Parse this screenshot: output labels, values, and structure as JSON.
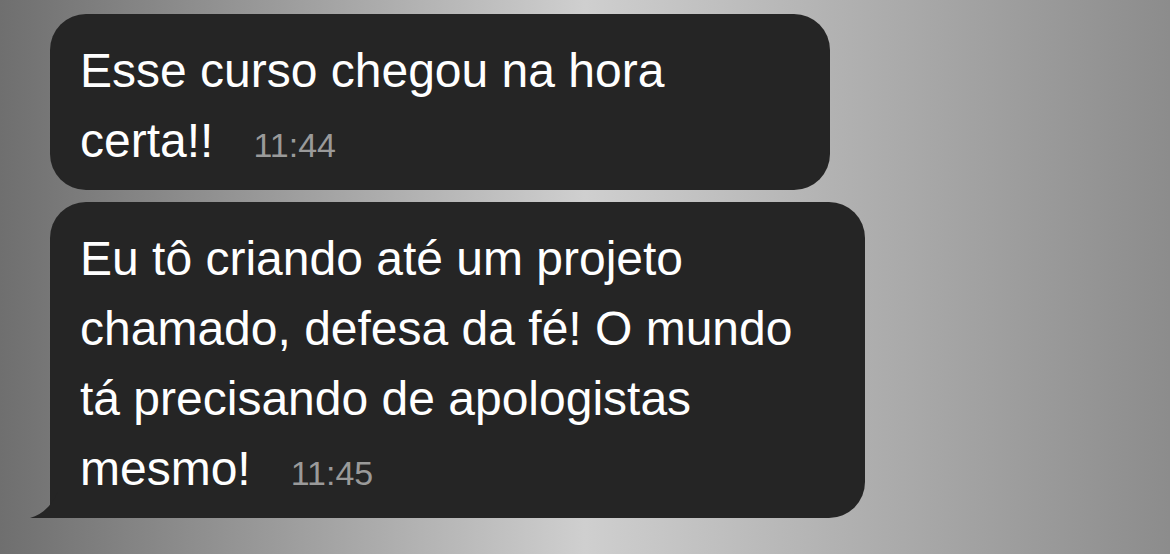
{
  "chat": {
    "messages": [
      {
        "text": "Esse curso chegou na hora certa!!",
        "time": "11:44",
        "tail": false
      },
      {
        "text": "Eu tô criando até um projeto chamado, defesa da fé! O mundo tá precisando de apologistas mesmo!",
        "time": "11:45",
        "tail": true
      }
    ]
  }
}
